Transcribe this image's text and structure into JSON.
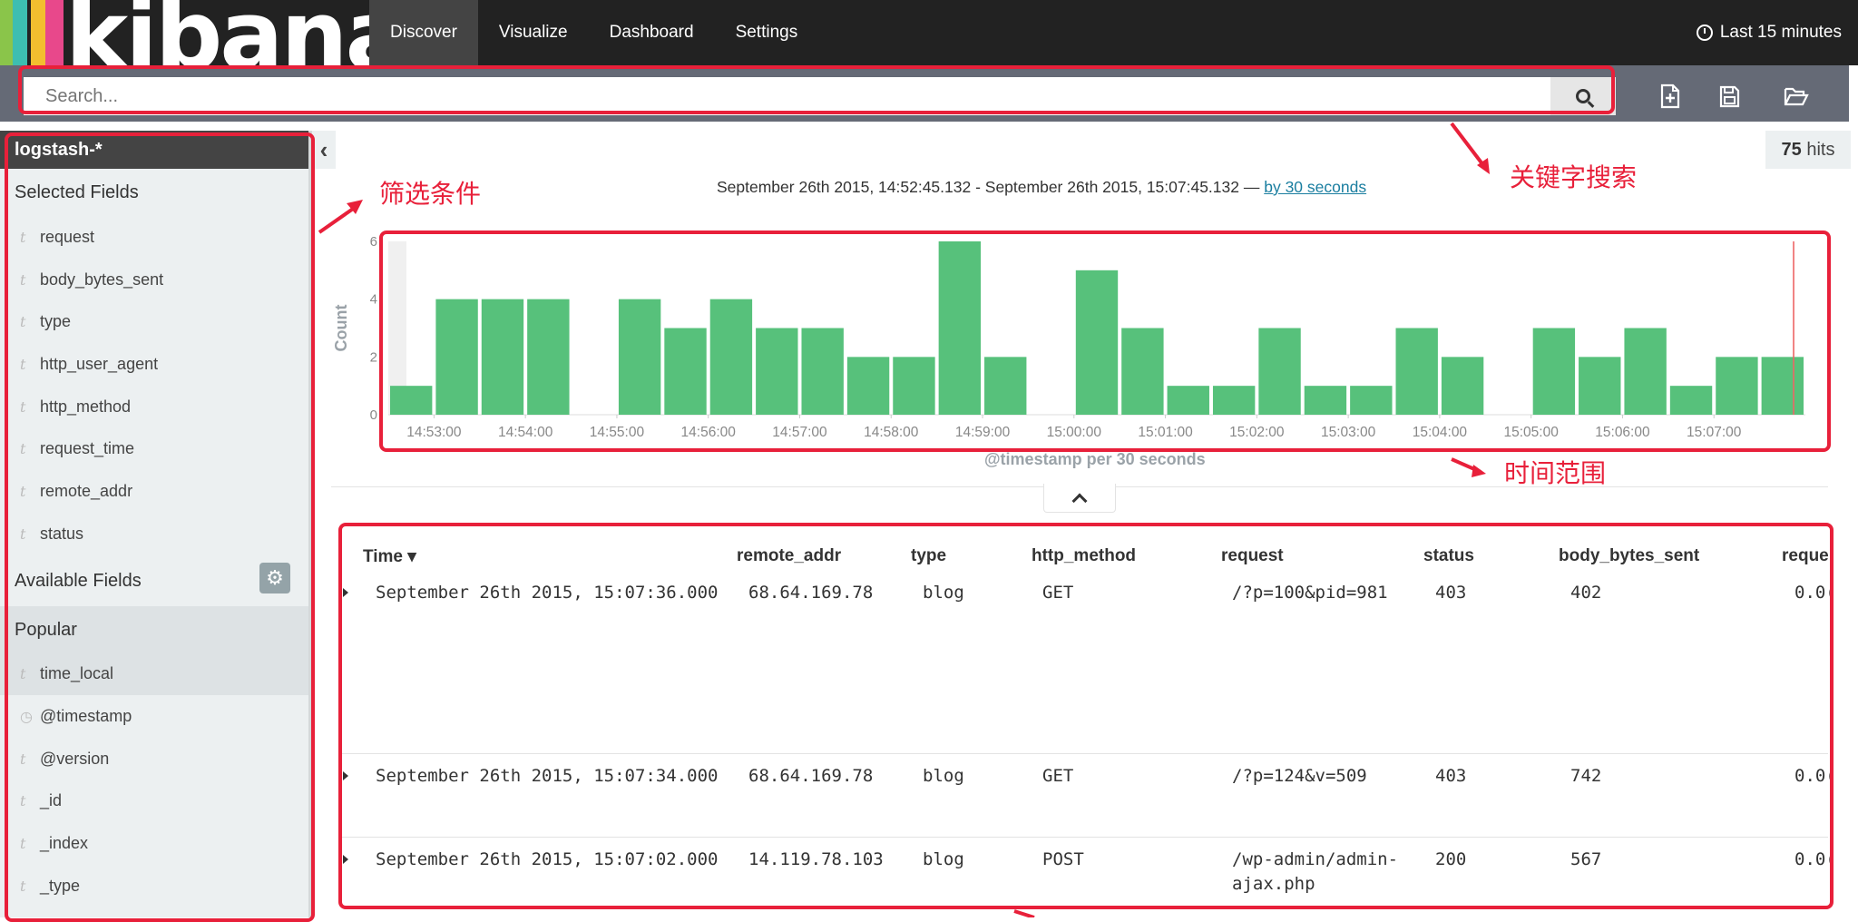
{
  "app": {
    "logo_text": "kibana",
    "brand_colors": [
      "#e8488b",
      "#f3bf2f",
      "#3dbeb0",
      "#8ac54a"
    ]
  },
  "nav": {
    "items": [
      {
        "label": "Discover",
        "active": true
      },
      {
        "label": "Visualize",
        "active": false
      },
      {
        "label": "Dashboard",
        "active": false
      },
      {
        "label": "Settings",
        "active": false
      }
    ],
    "time_label": "Last 15 minutes"
  },
  "search": {
    "placeholder": "Search...",
    "icons": [
      "search-icon",
      "new-search-icon",
      "save-search-icon",
      "open-search-icon"
    ]
  },
  "sidebar": {
    "index_pattern": "logstash-*",
    "selected_title": "Selected Fields",
    "selected_fields": [
      {
        "type": "t",
        "name": "request"
      },
      {
        "type": "t",
        "name": "body_bytes_sent"
      },
      {
        "type": "t",
        "name": "type"
      },
      {
        "type": "t",
        "name": "http_user_agent"
      },
      {
        "type": "t",
        "name": "http_method"
      },
      {
        "type": "t",
        "name": "request_time"
      },
      {
        "type": "t",
        "name": "remote_addr"
      },
      {
        "type": "t",
        "name": "status"
      }
    ],
    "available_title": "Available Fields",
    "popular_title": "Popular",
    "popular_fields": [
      {
        "type": "t",
        "name": "time_local"
      }
    ],
    "other_fields": [
      {
        "type": "clock",
        "name": "@timestamp"
      },
      {
        "type": "t",
        "name": "@version"
      },
      {
        "type": "t",
        "name": "_id"
      },
      {
        "type": "t",
        "name": "_index"
      },
      {
        "type": "t",
        "name": "_type"
      }
    ]
  },
  "hits": {
    "count": "75",
    "label": "hits"
  },
  "time_range": {
    "text": "September 26th 2015, 14:52:45.132 - September 26th 2015, 15:07:45.132 — ",
    "interval_link": "by 30 seconds"
  },
  "annotations": {
    "filter": "筛选条件",
    "keyword": "关键字搜索",
    "time": "时间范围"
  },
  "chart_data": {
    "type": "bar",
    "ylabel": "Count",
    "xlabel": "@timestamp per 30 seconds",
    "ylim": [
      0,
      6
    ],
    "yticks": [
      0,
      2,
      4,
      6
    ],
    "color": "#57c17b",
    "tick_labels": [
      "14:53:00",
      "14:54:00",
      "14:55:00",
      "14:56:00",
      "14:57:00",
      "14:58:00",
      "14:59:00",
      "15:00:00",
      "15:01:00",
      "15:02:00",
      "15:03:00",
      "15:04:00",
      "15:05:00",
      "15:06:00",
      "15:07:00"
    ],
    "bin_starts": [
      "14:52:30",
      "14:53:00",
      "14:53:30",
      "14:54:00",
      "14:54:30",
      "14:55:00",
      "14:55:30",
      "14:56:00",
      "14:56:30",
      "14:57:00",
      "14:57:30",
      "14:58:00",
      "14:58:30",
      "14:59:00",
      "14:59:30",
      "15:00:00",
      "15:00:30",
      "15:01:00",
      "15:01:30",
      "15:02:00",
      "15:02:30",
      "15:03:00",
      "15:03:30",
      "15:04:00",
      "15:04:30",
      "15:05:00",
      "15:05:30",
      "15:06:00",
      "15:06:30",
      "15:07:00",
      "15:07:30"
    ],
    "values": [
      1,
      4,
      4,
      4,
      0,
      4,
      3,
      4,
      3,
      3,
      2,
      2,
      6,
      2,
      0,
      5,
      3,
      1,
      1,
      3,
      1,
      1,
      3,
      2,
      0,
      3,
      2,
      3,
      1,
      2,
      2
    ]
  },
  "table": {
    "columns": [
      {
        "label": "Time",
        "sort": "▾"
      },
      {
        "label": "remote_addr"
      },
      {
        "label": "type"
      },
      {
        "label": "http_method"
      },
      {
        "label": "request"
      },
      {
        "label": "status"
      },
      {
        "label": "body_bytes_sent"
      },
      {
        "label": "reque"
      }
    ],
    "rows": [
      {
        "time": "September 26th 2015, 15:07:36.000",
        "remote_addr": "68.64.169.78",
        "type": "blog",
        "http_method": "GET",
        "request": "/?p=100&pid=981",
        "status": "403",
        "body_bytes_sent": "402",
        "request_time": "0.0("
      },
      {
        "time": "September 26th 2015, 15:07:34.000",
        "remote_addr": "68.64.169.78",
        "type": "blog",
        "http_method": "GET",
        "request": "/?p=124&v=509",
        "status": "403",
        "body_bytes_sent": "742",
        "request_time": "0.0("
      },
      {
        "time": "September 26th 2015, 15:07:02.000",
        "remote_addr": "14.119.78.103",
        "type": "blog",
        "http_method": "POST",
        "request": "/wp-admin/admin-",
        "request_cont": "ajax.php",
        "status": "200",
        "body_bytes_sent": "567",
        "request_time": "0.0("
      }
    ]
  }
}
